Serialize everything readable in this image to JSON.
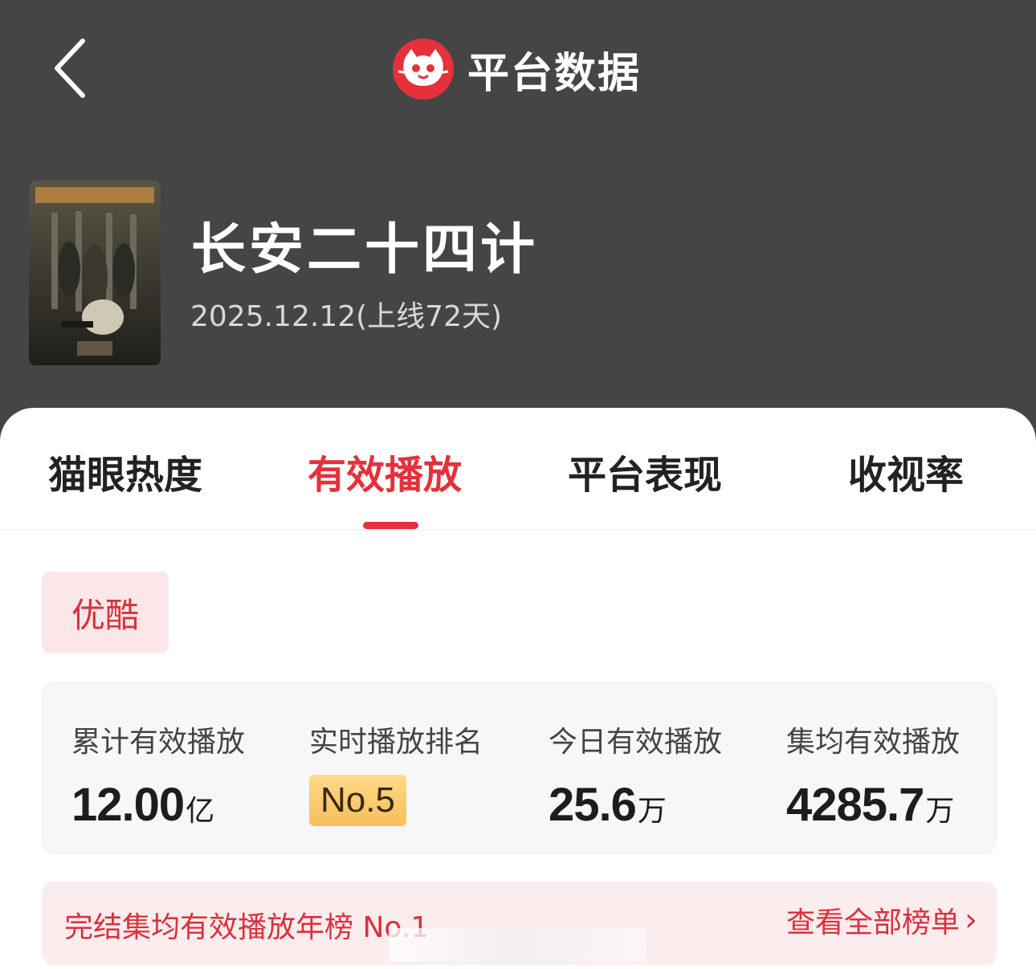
{
  "header": {
    "title": "平台数据",
    "logo_icon": "maoyan-cat-logo-icon",
    "back_icon": "chevron-left-icon"
  },
  "show": {
    "title": "长安二十四计",
    "release": "2025.12.12(上线72天)"
  },
  "tabs": [
    {
      "label": "猫眼热度",
      "active": false
    },
    {
      "label": "有效播放",
      "active": true
    },
    {
      "label": "平台表现",
      "active": false
    },
    {
      "label": "收视率",
      "active": false
    }
  ],
  "platform": {
    "label": "优酷"
  },
  "stats": [
    {
      "label": "累计有效播放",
      "value": "12.00",
      "unit": "亿"
    },
    {
      "label": "实时播放排名",
      "value": "No.5",
      "unit": ""
    },
    {
      "label": "今日有效播放",
      "value": "25.6",
      "unit": "万"
    },
    {
      "label": "集均有效播放",
      "value": "4285.7",
      "unit": "万"
    }
  ],
  "rank_banner": {
    "text": "完结集均有效播放年榜 No.1",
    "link": "查看全部榜单"
  },
  "colors": {
    "accent": "#e4313b",
    "header_bg": "#454545",
    "chip_bg": "#fbe6e8",
    "badge_gold": "#f6bf5c"
  }
}
